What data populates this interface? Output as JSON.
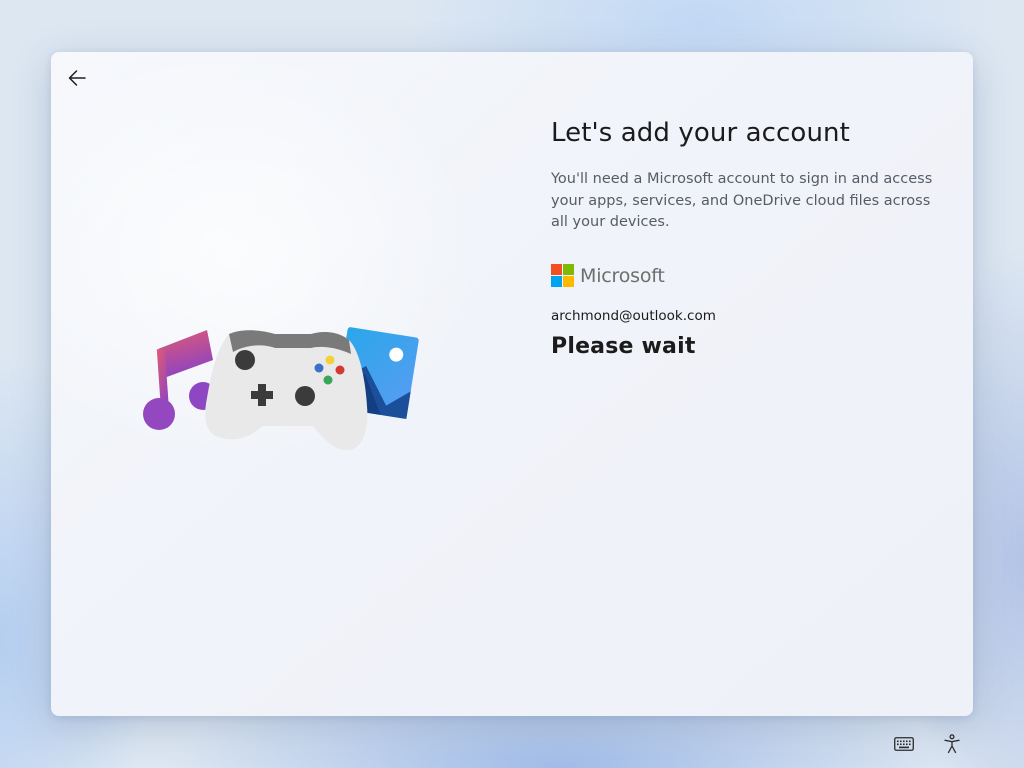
{
  "page": {
    "title": "Let's add your account",
    "description": "You'll need a Microsoft account to sign in and access your apps, services, and OneDrive cloud files across all your devices.",
    "brand": {
      "name": "Microsoft",
      "colors": [
        "#f25022",
        "#7fba00",
        "#00a4ef",
        "#ffb900"
      ]
    },
    "email": "archmond@outlook.com",
    "status": "Please wait"
  },
  "nav": {
    "back_icon": "arrow-left-icon"
  },
  "illustration": {
    "icons": [
      "music-note-icon",
      "game-controller-icon",
      "photo-icon"
    ]
  },
  "footer": {
    "icons": [
      "keyboard-icon",
      "accessibility-icon"
    ]
  }
}
